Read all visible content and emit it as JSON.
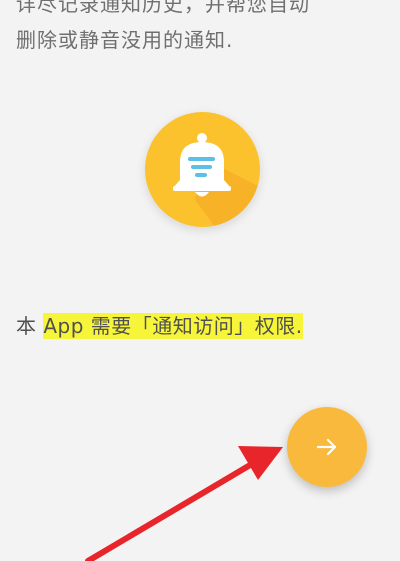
{
  "intro": {
    "line1": "详尽记录通知历史，并帮您自动",
    "line2": "删除或静音没用的通知."
  },
  "permission": {
    "prefix": "本 ",
    "highlighted": "App 需要「通知访问」权限."
  },
  "icons": {
    "bell": "bell-icon",
    "next": "arrow-right-icon",
    "annotation": "red-arrow-annotation"
  },
  "colors": {
    "background": "#f3f3f3",
    "bell_badge": "#fbc22e",
    "next_button": "#f9b93d",
    "highlight": "#f6f53a",
    "annotation": "#e8252b"
  }
}
